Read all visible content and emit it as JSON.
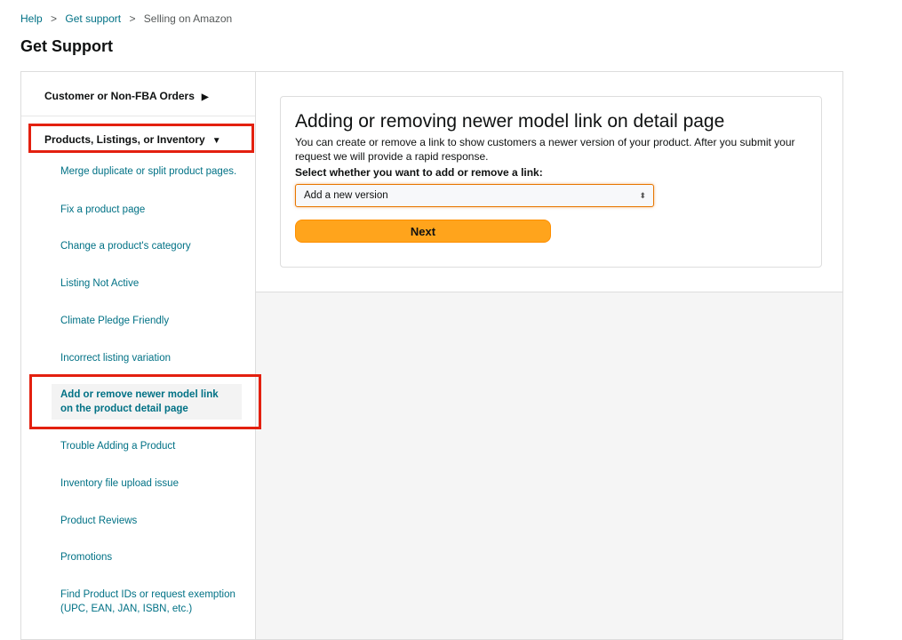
{
  "breadcrumb": {
    "items": [
      "Help",
      "Get support",
      "Selling on Amazon"
    ],
    "separator": ">"
  },
  "page": {
    "title": "Get Support"
  },
  "sidebar": {
    "categories": [
      {
        "label": "Customer or Non-FBA Orders",
        "icon": "triangle-right-icon",
        "glyph": "▶"
      },
      {
        "label": "Products, Listings, or Inventory",
        "icon": "triangle-down-icon",
        "glyph": "▼"
      }
    ],
    "items": [
      {
        "label": "Merge duplicate or split product pages."
      },
      {
        "label": "Fix a product page"
      },
      {
        "label": "Change a product's category"
      },
      {
        "label": "Listing Not Active"
      },
      {
        "label": "Climate Pledge Friendly"
      },
      {
        "label": "Incorrect listing variation"
      },
      {
        "label": "Add or remove newer model link on the product detail page",
        "active": true
      },
      {
        "label": "Trouble Adding a Product"
      },
      {
        "label": "Inventory file upload issue"
      },
      {
        "label": "Product Reviews"
      },
      {
        "label": "Promotions"
      },
      {
        "label": "Find Product IDs or request exemption (UPC, EAN, JAN, ISBN, etc.)"
      }
    ]
  },
  "form": {
    "title": "Adding or removing newer model link on detail page",
    "description": "You can create or remove a link to show customers a newer version of your product. After you submit your request we will provide a rapid response.",
    "select_label": "Select whether you want to add or remove a link:",
    "select_value": "Add a new version",
    "select_arrows": "⬍",
    "next_label": "Next"
  },
  "colors": {
    "link": "#007185",
    "button": "#ffa41c",
    "highlight_box": "#e3200f",
    "text": "#0f1111"
  }
}
